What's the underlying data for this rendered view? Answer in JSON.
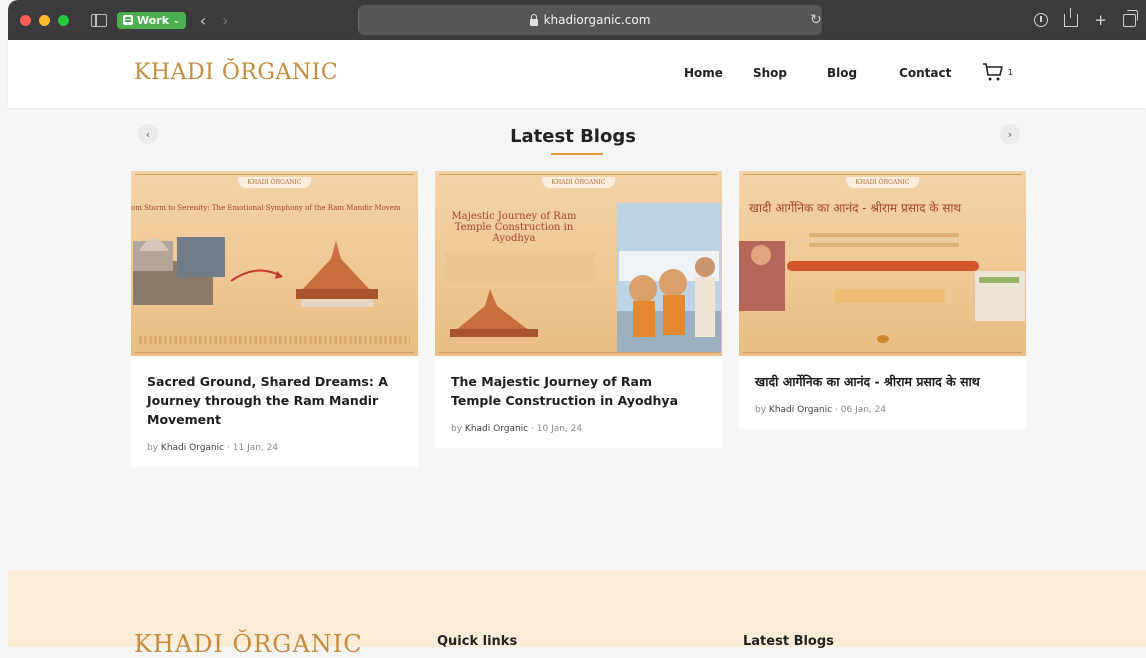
{
  "browser": {
    "tab_group": "Work",
    "address": "khadiorganic.com"
  },
  "header": {
    "logo": "KHADI ŎRGANIC",
    "nav": [
      "Home",
      "Shop",
      "Blog",
      "Contact"
    ],
    "cart_count": "1"
  },
  "blogs": {
    "title": "Latest Blogs",
    "posts": [
      {
        "image_badge": "KHADI ŎRGANIC",
        "image_headline": "om Storm to Serenity: The Emotional Symphony of the Ram Mandir Movem",
        "title": "Sacred Ground, Shared Dreams: A Journey through the Ram Mandir Movement",
        "by": "by",
        "author": "Khadi Organic",
        "date": "11 Jan, 24"
      },
      {
        "image_badge": "KHADI ŎRGANIC",
        "image_headline": "Majestic Journey of Ram Temple Construction in Ayodhya",
        "title": "The Majestic Journey of Ram Temple Construction in Ayodhya",
        "by": "by",
        "author": "Khadi Organic",
        "date": "10 Jan, 24"
      },
      {
        "image_badge": "KHADI ŎRGANIC",
        "image_headline": "खादी आर्गेनिक का आनंद - श्रीराम प्रसाद के साथ",
        "title": "खादी आर्गेनिक का आनंद - श्रीराम प्रसाद के साथ",
        "by": "by",
        "author": "Khadi Organic",
        "date": "06 Jan, 24"
      }
    ]
  },
  "footer": {
    "logo": "KHADI ŎRGANIC",
    "quick_links": "Quick links",
    "latest_blogs": "Latest Blogs"
  },
  "colors": {
    "accent": "#e09a3a",
    "logo": "#c58b3e",
    "footer_bg": "#fbecd7"
  }
}
